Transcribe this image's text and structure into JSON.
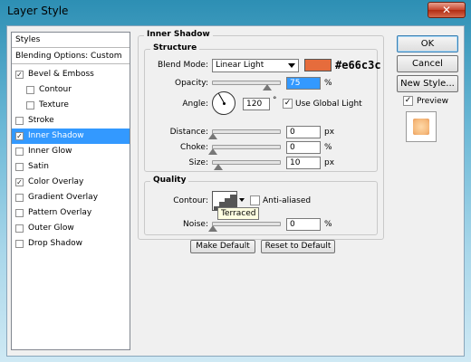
{
  "window": {
    "title": "Layer Style",
    "close_glyph": "✕"
  },
  "styles_list": {
    "header": "Styles",
    "blending": "Blending Options: Custom",
    "items": [
      {
        "label": "Bevel & Emboss",
        "checked": true,
        "indent": false,
        "selected": false
      },
      {
        "label": "Contour",
        "checked": false,
        "indent": true,
        "selected": false
      },
      {
        "label": "Texture",
        "checked": false,
        "indent": true,
        "selected": false
      },
      {
        "label": "Stroke",
        "checked": false,
        "indent": false,
        "selected": false
      },
      {
        "label": "Inner Shadow",
        "checked": true,
        "indent": false,
        "selected": true
      },
      {
        "label": "Inner Glow",
        "checked": false,
        "indent": false,
        "selected": false
      },
      {
        "label": "Satin",
        "checked": false,
        "indent": false,
        "selected": false
      },
      {
        "label": "Color Overlay",
        "checked": true,
        "indent": false,
        "selected": false
      },
      {
        "label": "Gradient Overlay",
        "checked": false,
        "indent": false,
        "selected": false
      },
      {
        "label": "Pattern Overlay",
        "checked": false,
        "indent": false,
        "selected": false
      },
      {
        "label": "Outer Glow",
        "checked": false,
        "indent": false,
        "selected": false
      },
      {
        "label": "Drop Shadow",
        "checked": false,
        "indent": false,
        "selected": false
      }
    ]
  },
  "panel": {
    "title": "Inner Shadow",
    "structure": {
      "title": "Structure",
      "blend_mode_label": "Blend Mode:",
      "blend_mode_value": "Linear Light",
      "color_hex": "#e66c3c",
      "opacity_label": "Opacity:",
      "opacity_value": "75",
      "opacity_unit": "%",
      "angle_label": "Angle:",
      "angle_value": "120",
      "angle_unit": "°",
      "global_light_label": "Use Global Light",
      "global_light_checked": true,
      "distance_label": "Distance:",
      "distance_value": "0",
      "distance_unit": "px",
      "choke_label": "Choke:",
      "choke_value": "0",
      "choke_unit": "%",
      "size_label": "Size:",
      "size_value": "10",
      "size_unit": "px"
    },
    "quality": {
      "title": "Quality",
      "contour_label": "Contour:",
      "contour_tooltip": "Terraced",
      "anti_aliased_label": "Anti-aliased",
      "anti_aliased_checked": false,
      "noise_label": "Noise:",
      "noise_value": "0",
      "noise_unit": "%"
    },
    "make_default_label": "Make Default",
    "reset_default_label": "Reset to Default"
  },
  "buttons": {
    "ok": "OK",
    "cancel": "Cancel",
    "new_style": "New Style...",
    "preview_label": "Preview",
    "preview_checked": true
  },
  "colors": {
    "selection": "#3399ff",
    "shadow_color": "#e66c3c",
    "close_button": "#c7452d"
  }
}
